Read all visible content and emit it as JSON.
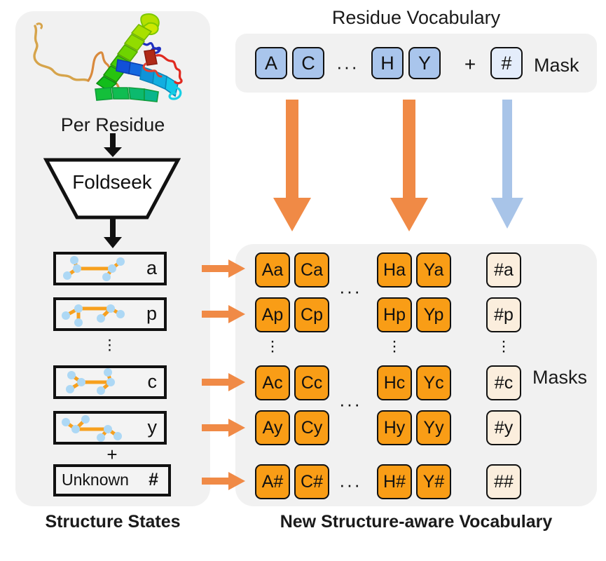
{
  "titles": {
    "residue_vocabulary": "Residue Vocabulary",
    "per_residue": "Per Residue",
    "structure_states": "Structure States",
    "new_vocabulary": "New Structure-aware Vocabulary"
  },
  "labels": {
    "foldseek": "Foldseek",
    "mask": "Mask",
    "masks": "Masks",
    "plus": "+",
    "unknown": "Unknown",
    "unknown_symbol": "#",
    "ellipsis": "···",
    "dot": "·"
  },
  "residue_vocabulary": {
    "tiles": [
      {
        "label": "A",
        "kind": "residue"
      },
      {
        "label": "C",
        "kind": "residue"
      },
      {
        "label": "H",
        "kind": "residue"
      },
      {
        "label": "Y",
        "kind": "residue"
      },
      {
        "label": "#",
        "kind": "mask"
      }
    ],
    "plus_sign": "+",
    "mask_label": "Mask"
  },
  "structure_states": {
    "rows": [
      {
        "letter": "a",
        "glyph": "structure-state-graph-a"
      },
      {
        "letter": "p",
        "glyph": "structure-state-graph-p"
      },
      {
        "letter": "c",
        "glyph": "structure-state-graph-c"
      },
      {
        "letter": "y",
        "glyph": "structure-state-graph-y"
      }
    ],
    "unknown_row": {
      "text": "Unknown",
      "symbol": "#"
    }
  },
  "vocabulary_grid": {
    "rows": [
      {
        "tokens": [
          "Aa",
          "Ca",
          "Ha",
          "Ya"
        ],
        "mask_token": "#a"
      },
      {
        "tokens": [
          "Ap",
          "Cp",
          "Hp",
          "Yp"
        ],
        "mask_token": "#p"
      },
      {
        "tokens": [
          "Ac",
          "Cc",
          "Hc",
          "Yc"
        ],
        "mask_token": "#c"
      },
      {
        "tokens": [
          "Ay",
          "Cy",
          "Hy",
          "Yy"
        ],
        "mask_token": "#y"
      },
      {
        "tokens": [
          "A#",
          "C#",
          "H#",
          "Y#"
        ],
        "mask_token": "##"
      }
    ],
    "masks_label": "Masks"
  },
  "colors": {
    "panel_background": "#f1f1f1",
    "residue_tile": "#a9c5ec",
    "residue_mask_tile": "#e4edfb",
    "token_tile": "#f99d16",
    "token_mask_tile": "#fbeedd",
    "arrow_orange": "#f08a46",
    "arrow_blue": "#a8c4e8",
    "outline": "#111111",
    "glyph_edge": "#f7a01e",
    "glyph_node": "#add8f5"
  }
}
